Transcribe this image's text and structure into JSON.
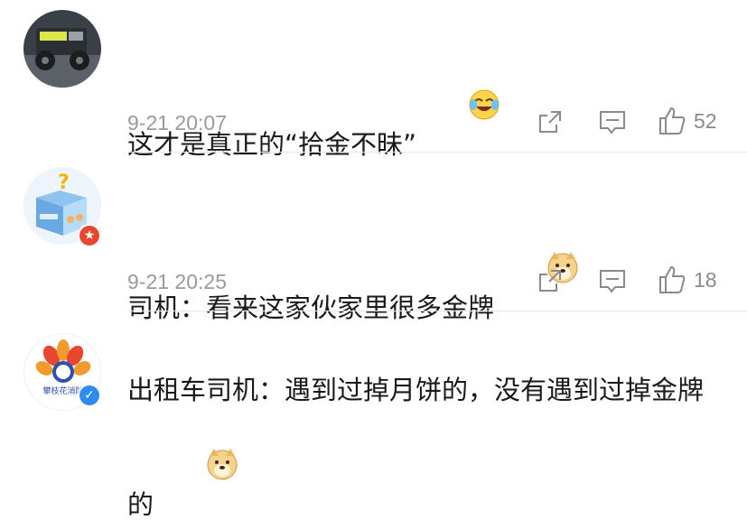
{
  "comments": [
    {
      "text": "这才是真正的“拾金不昧”",
      "emoji": "laughing-tears-emoji",
      "time": "9-21 20:07",
      "likes": "52",
      "avatar": "jeep-avatar",
      "badge": null
    },
    {
      "text": "司机：看来这家伙家里很多金牌",
      "emoji": "doge-emoji",
      "time": "9-21 20:25",
      "likes": "18",
      "avatar": "mystery-box-avatar",
      "badge": "red-star-badge"
    },
    {
      "text": "出租车司机：遇到过掉月饼的，没有遇到过掉金牌的",
      "emoji": "doge-emoji",
      "avatar": "school-flower-logo-avatar",
      "avatar_text": "攀枝花消防",
      "badge": "blue-verified-badge"
    }
  ],
  "colors": {
    "text": "#1a1a1a",
    "meta": "#9a9a9a",
    "divider": "#e7e7e7",
    "red_badge": "#e8472f",
    "blue_badge": "#2d8cf0"
  }
}
